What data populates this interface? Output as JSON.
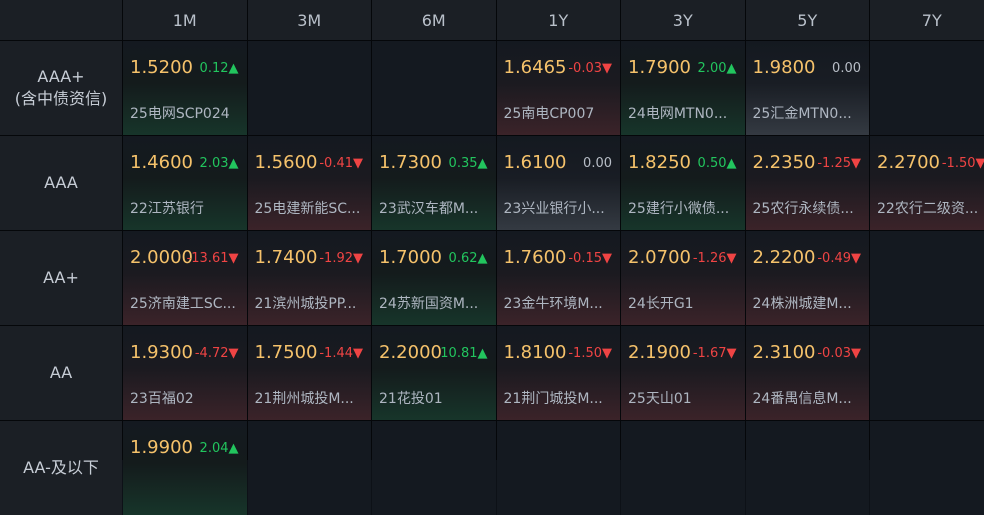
{
  "columns": [
    "1M",
    "3M",
    "6M",
    "1Y",
    "3Y",
    "5Y",
    "7Y"
  ],
  "rows": [
    {
      "label": "AAA+\n(含中债资信)",
      "cells": [
        {
          "yield": "1.5200",
          "change": "0.12",
          "dir": "up",
          "arrow": "▲",
          "bond": "25电网SCP024"
        },
        null,
        null,
        {
          "yield": "1.6465",
          "change": "-0.03",
          "dir": "down",
          "arrow": "▼",
          "bond": "25南电CP007"
        },
        {
          "yield": "1.7900",
          "change": "2.00",
          "dir": "up",
          "arrow": "▲",
          "bond": "24电网MTN0..."
        },
        {
          "yield": "1.9800",
          "change": "0.00",
          "dir": "flat",
          "arrow": "",
          "bond": "25汇金MTN0..."
        },
        null
      ]
    },
    {
      "label": "AAA",
      "cells": [
        {
          "yield": "1.4600",
          "change": "2.03",
          "dir": "up",
          "arrow": "▲",
          "bond": "22江苏银行"
        },
        {
          "yield": "1.5600",
          "change": "-0.41",
          "dir": "down",
          "arrow": "▼",
          "bond": "25电建新能SC..."
        },
        {
          "yield": "1.7300",
          "change": "0.35",
          "dir": "up",
          "arrow": "▲",
          "bond": "23武汉车都M..."
        },
        {
          "yield": "1.6100",
          "change": "0.00",
          "dir": "flat",
          "arrow": "",
          "bond": "23兴业银行小..."
        },
        {
          "yield": "1.8250",
          "change": "0.50",
          "dir": "up",
          "arrow": "▲",
          "bond": "25建行小微债..."
        },
        {
          "yield": "2.2350",
          "change": "-1.25",
          "dir": "down",
          "arrow": "▼",
          "bond": "25农行永续债..."
        },
        {
          "yield": "2.2700",
          "change": "-1.50",
          "dir": "down",
          "arrow": "▼",
          "bond": "22农行二级资..."
        }
      ]
    },
    {
      "label": "AA+",
      "cells": [
        {
          "yield": "2.0000",
          "change": "-13.61",
          "dir": "down",
          "arrow": "▼",
          "bond": "25济南建工SC..."
        },
        {
          "yield": "1.7400",
          "change": "-1.92",
          "dir": "down",
          "arrow": "▼",
          "bond": "21滨州城投PP..."
        },
        {
          "yield": "1.7000",
          "change": "0.62",
          "dir": "up",
          "arrow": "▲",
          "bond": "24苏新国资M..."
        },
        {
          "yield": "1.7600",
          "change": "-0.15",
          "dir": "down",
          "arrow": "▼",
          "bond": "23金牛环境M..."
        },
        {
          "yield": "2.0700",
          "change": "-1.26",
          "dir": "down",
          "arrow": "▼",
          "bond": "24长开G1"
        },
        {
          "yield": "2.2200",
          "change": "-0.49",
          "dir": "down",
          "arrow": "▼",
          "bond": "24株洲城建M..."
        },
        null
      ]
    },
    {
      "label": "AA",
      "cells": [
        {
          "yield": "1.9300",
          "change": "-4.72",
          "dir": "down",
          "arrow": "▼",
          "bond": "23百福02"
        },
        {
          "yield": "1.7500",
          "change": "-1.44",
          "dir": "down",
          "arrow": "▼",
          "bond": "21荆州城投M..."
        },
        {
          "yield": "2.2000",
          "change": "10.81",
          "dir": "up",
          "arrow": "▲",
          "bond": "21花投01"
        },
        {
          "yield": "1.8100",
          "change": "-1.50",
          "dir": "down",
          "arrow": "▼",
          "bond": "21荆门城投M..."
        },
        {
          "yield": "2.1900",
          "change": "-1.67",
          "dir": "down",
          "arrow": "▼",
          "bond": "25天山01"
        },
        {
          "yield": "2.3100",
          "change": "-0.03",
          "dir": "down",
          "arrow": "▼",
          "bond": "24番禺信息M..."
        },
        null
      ]
    },
    {
      "label": "AA-及以下",
      "cells": [
        {
          "yield": "1.9900",
          "change": "2.04",
          "dir": "up",
          "arrow": "▲",
          "bond": ""
        },
        null,
        null,
        null,
        null,
        null,
        null
      ]
    }
  ]
}
